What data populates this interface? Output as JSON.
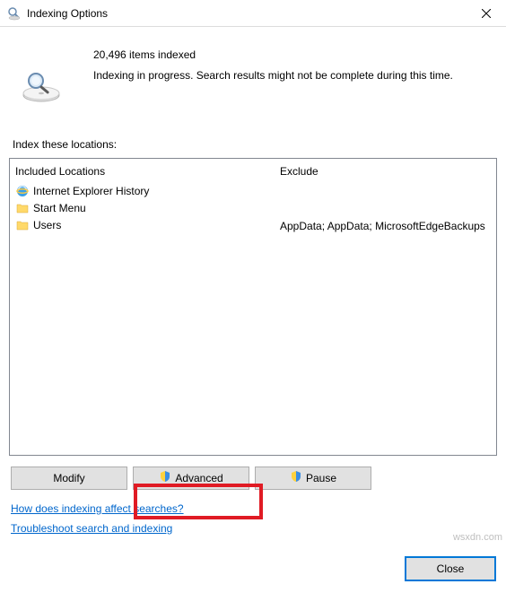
{
  "window": {
    "title": "Indexing Options"
  },
  "status": {
    "count_text": "20,496 items indexed",
    "progress_text": "Indexing in progress. Search results might not be complete during this time."
  },
  "section_label": "Index these locations:",
  "columns": {
    "included_header": "Included Locations",
    "exclude_header": "Exclude"
  },
  "locations": [
    {
      "icon": "ie",
      "name": "Internet Explorer History",
      "exclude": ""
    },
    {
      "icon": "folder",
      "name": "Start Menu",
      "exclude": ""
    },
    {
      "icon": "folder",
      "name": "Users",
      "exclude": "AppData; AppData; MicrosoftEdgeBackups"
    }
  ],
  "buttons": {
    "modify": "Modify",
    "advanced": "Advanced",
    "pause": "Pause",
    "close": "Close"
  },
  "links": {
    "help": "How does indexing affect searches?",
    "troubleshoot": "Troubleshoot search and indexing"
  },
  "watermark": "wsxdn.com"
}
